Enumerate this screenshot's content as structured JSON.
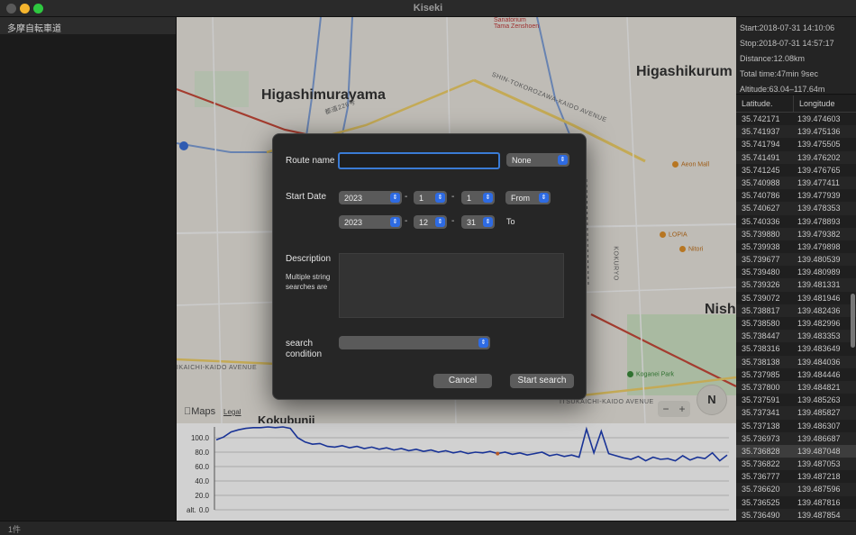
{
  "window": {
    "title": "Kiseki"
  },
  "sidebar": {
    "items": [
      {
        "label": "多摩自転車道"
      }
    ]
  },
  "statusbar": {
    "text": "1件"
  },
  "map": {
    "labels": {
      "higashimurayama": "Higashimurayama",
      "higashikurume": "Higashikurum",
      "nishi": "Nish",
      "kokubunji": "Kokubunji",
      "shintokorozawa": "SHIN-TOKOROZAWA-KAIDO AVENUE",
      "kokuryo": "KOKURYO",
      "ikaichi1": "IKAICHI-KAIDO AVENUE",
      "ikaichi2": "ITSUKAICHI-KAIDO AVENUE",
      "road226": "都道226号"
    },
    "pois": {
      "sanatorium": "Sanatorium\nTama Zenshoen",
      "aeon": "Aeon Mall",
      "lopia": "LOPIA",
      "nitori": "Nitori",
      "koganei": "Koganei Park"
    },
    "brand": "Maps",
    "legal": "Legal",
    "compass": "N",
    "zoom_out": "−",
    "zoom_in": "+"
  },
  "info": {
    "start": "Start:2018-07-31 14:10:06",
    "stop": "Stop:2018-07-31 14:57:17",
    "distance": "Distance:12.08km",
    "total_time": "Total time:47min 9sec",
    "altitude": "Altitude:63.04–117.64m"
  },
  "table": {
    "headers": {
      "lat": "Latitude.",
      "lon": "Longitude"
    },
    "rows": [
      [
        "35.742171",
        "139.474603"
      ],
      [
        "35.741937",
        "139.475136"
      ],
      [
        "35.741794",
        "139.475505"
      ],
      [
        "35.741491",
        "139.476202"
      ],
      [
        "35.741245",
        "139.476765"
      ],
      [
        "35.740988",
        "139.477411"
      ],
      [
        "35.740786",
        "139.477939"
      ],
      [
        "35.740627",
        "139.478353"
      ],
      [
        "35.740336",
        "139.478893"
      ],
      [
        "35.739880",
        "139.479382"
      ],
      [
        "35.739938",
        "139.479898"
      ],
      [
        "35.739677",
        "139.480539"
      ],
      [
        "35.739480",
        "139.480989"
      ],
      [
        "35.739326",
        "139.481331"
      ],
      [
        "35.739072",
        "139.481946"
      ],
      [
        "35.738817",
        "139.482436"
      ],
      [
        "35.738580",
        "139.482996"
      ],
      [
        "35.738447",
        "139.483353"
      ],
      [
        "35.738316",
        "139.483649"
      ],
      [
        "35.738138",
        "139.484036"
      ],
      [
        "35.737985",
        "139.484446"
      ],
      [
        "35.737800",
        "139.484821"
      ],
      [
        "35.737591",
        "139.485263"
      ],
      [
        "35.737341",
        "139.485827"
      ],
      [
        "35.737138",
        "139.486307"
      ],
      [
        "35.736973",
        "139.486687"
      ],
      [
        "35.736828",
        "139.487048"
      ],
      [
        "35.736822",
        "139.487053"
      ],
      [
        "35.736777",
        "139.487218"
      ],
      [
        "35.736620",
        "139.487596"
      ],
      [
        "35.736525",
        "139.487816"
      ],
      [
        "35.736490",
        "139.487854"
      ]
    ],
    "selected_index": 26
  },
  "chart_data": {
    "type": "line",
    "ylabel": "alt.",
    "ylim": [
      0,
      110
    ],
    "yticks": [
      "0.0",
      "20.0",
      "40.0",
      "60.0",
      "80.0",
      "100.0"
    ],
    "series": [
      {
        "values": [
          97,
          101,
          108,
          111,
          113,
          114,
          114,
          115,
          114,
          115,
          113,
          100,
          94,
          91,
          92,
          88,
          87,
          89,
          86,
          88,
          85,
          87,
          84,
          86,
          83,
          85,
          82,
          84,
          81,
          83,
          80,
          82,
          79,
          81,
          78,
          80,
          79,
          81,
          78,
          80,
          77,
          79,
          76,
          78,
          80,
          75,
          77,
          74,
          76,
          73,
          112,
          79,
          109,
          78,
          75,
          72,
          70,
          74,
          68,
          73,
          70,
          71,
          68,
          75,
          69,
          73,
          71,
          79,
          68,
          76
        ]
      }
    ],
    "colors": {
      "line": "#1f3fb8",
      "marker": "#e07030"
    }
  },
  "dialog": {
    "route_name_label": "Route name",
    "route_name_value": "",
    "route_option": "None",
    "start_date_label": "Start Date",
    "from": {
      "year": "2023",
      "month": "1",
      "day": "1",
      "mode": "From"
    },
    "to": {
      "year": "2023",
      "month": "12",
      "day": "31",
      "mode": "To"
    },
    "description_label": "Description",
    "description_note": "Multiple string searches are",
    "search_condition_label": "search condition",
    "search_condition_value": "",
    "cancel": "Cancel",
    "start_search": "Start search",
    "dash": "-",
    "arrows": "⇕"
  }
}
